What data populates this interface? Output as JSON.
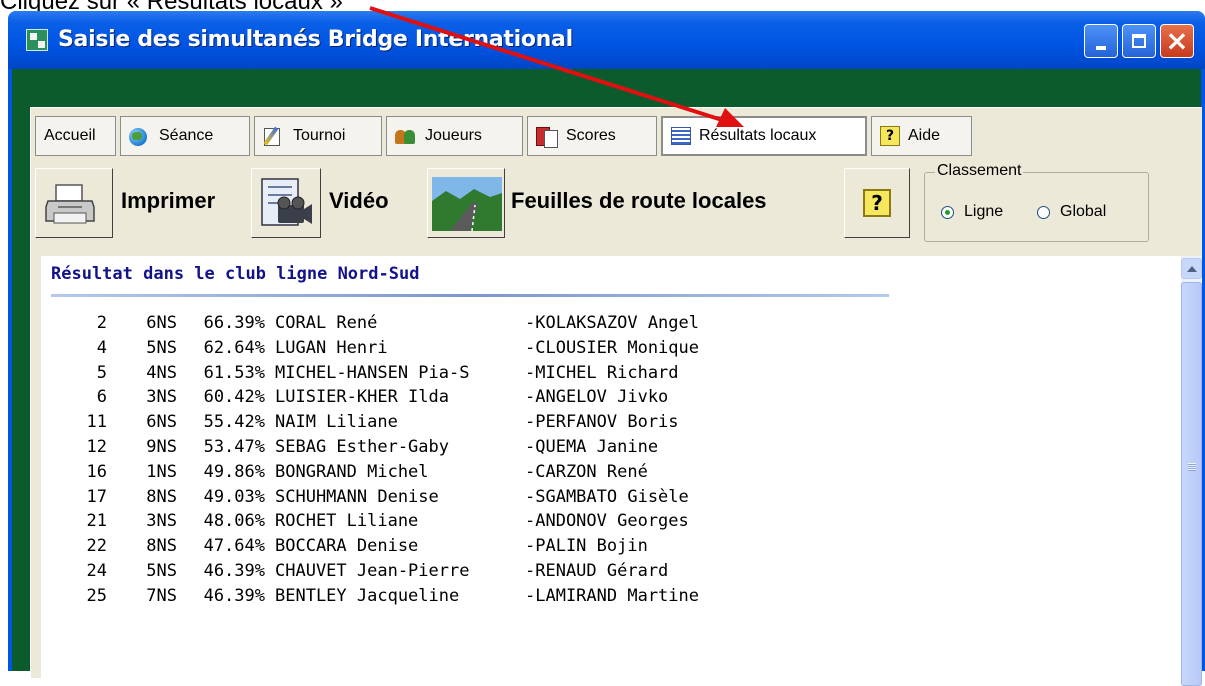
{
  "caption": "Cliquez sur « Résultats locaux »",
  "window": {
    "title": "Saisie des simultanés Bridge International"
  },
  "tabs": [
    {
      "label": "Accueil"
    },
    {
      "label": "Séance"
    },
    {
      "label": "Tournoi"
    },
    {
      "label": "Joueurs"
    },
    {
      "label": "Scores"
    },
    {
      "label": "Résultats locaux"
    },
    {
      "label": "Aide"
    }
  ],
  "toolbar": {
    "print_label": "Imprimer",
    "video_label": "Vidéo",
    "route_label": "Feuilles de route locales",
    "help_glyph": "?"
  },
  "classement": {
    "title": "Classement",
    "option_ligne": "Ligne",
    "option_global": "Global",
    "selected": "Ligne"
  },
  "results": {
    "title": "Résultat dans le club ligne Nord-Sud",
    "rows": [
      {
        "rank": "2",
        "seat": "6NS",
        "pct": "66.39%",
        "north": "CORAL René",
        "south": "-KOLAKSAZOV Angel"
      },
      {
        "rank": "4",
        "seat": "5NS",
        "pct": "62.64%",
        "north": "LUGAN Henri",
        "south": "-CLOUSIER Monique"
      },
      {
        "rank": "5",
        "seat": "4NS",
        "pct": "61.53%",
        "north": "MICHEL-HANSEN Pia-S",
        "south": "-MICHEL Richard"
      },
      {
        "rank": "6",
        "seat": "3NS",
        "pct": "60.42%",
        "north": "LUISIER-KHER Ilda",
        "south": "-ANGELOV Jivko"
      },
      {
        "rank": "11",
        "seat": "6NS",
        "pct": "55.42%",
        "north": "NAIM Liliane",
        "south": "-PERFANOV Boris"
      },
      {
        "rank": "12",
        "seat": "9NS",
        "pct": "53.47%",
        "north": "SEBAG Esther-Gaby",
        "south": "-QUEMA Janine"
      },
      {
        "rank": "16",
        "seat": "1NS",
        "pct": "49.86%",
        "north": "BONGRAND Michel",
        "south": "-CARZON René"
      },
      {
        "rank": "17",
        "seat": "8NS",
        "pct": "49.03%",
        "north": "SCHUHMANN Denise",
        "south": "-SGAMBATO Gisèle"
      },
      {
        "rank": "21",
        "seat": "3NS",
        "pct": "48.06%",
        "north": "ROCHET Liliane",
        "south": "-ANDONOV Georges"
      },
      {
        "rank": "22",
        "seat": "8NS",
        "pct": "47.64%",
        "north": "BOCCARA Denise",
        "south": "-PALIN Bojin"
      },
      {
        "rank": "24",
        "seat": "5NS",
        "pct": "46.39%",
        "north": "CHAUVET Jean-Pierre",
        "south": "-RENAUD Gérard"
      },
      {
        "rank": "25",
        "seat": "7NS",
        "pct": "46.39%",
        "north": "BENTLEY Jacqueline",
        "south": "-LAMIRAND Martine"
      }
    ]
  },
  "colors": {
    "client_bg": "#0c5b2d",
    "titlebar": "#0054e3",
    "results_title": "#12128a",
    "annotation_arrow": "#e01010"
  }
}
